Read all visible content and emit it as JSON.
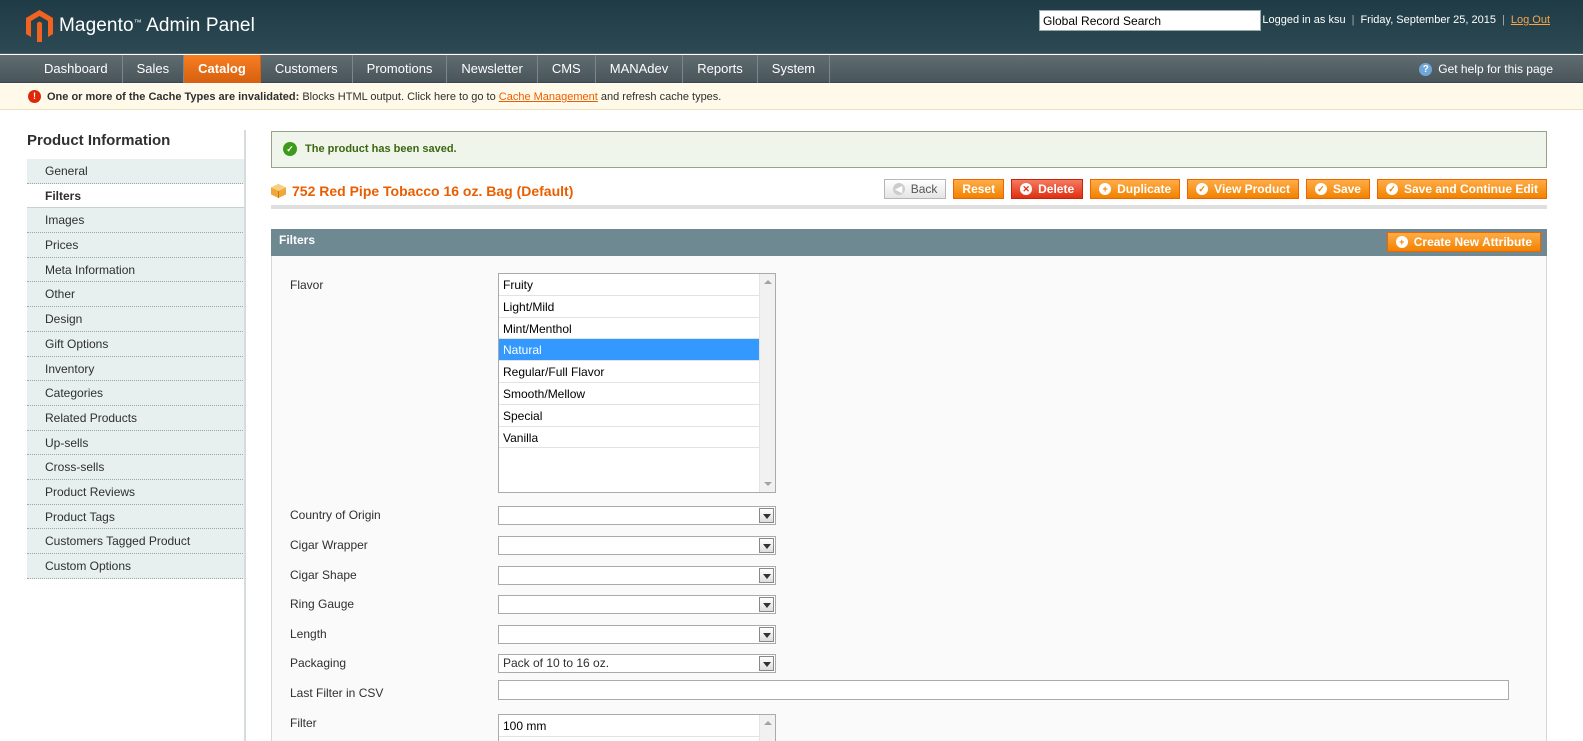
{
  "header": {
    "logo_text": "Magento",
    "logo_tm": "™",
    "logo_suffix": "Admin Panel",
    "search_value": "Global Record Search",
    "logged_in": "Logged in as ksu",
    "date": "Friday, September 25, 2015",
    "logout": "Log Out",
    "sep": "|"
  },
  "nav": {
    "items": [
      "Dashboard",
      "Sales",
      "Catalog",
      "Customers",
      "Promotions",
      "Newsletter",
      "CMS",
      "MANAdev",
      "Reports",
      "System"
    ],
    "active": "Catalog",
    "help": "Get help for this page"
  },
  "notice": {
    "bold": "One or more of the Cache Types are invalidated:",
    "text1": " Blocks HTML output. Click here to go to ",
    "link": "Cache Management",
    "text2": " and refresh cache types."
  },
  "sidebar": {
    "title": "Product Information",
    "items": [
      "General",
      "Filters",
      "Images",
      "Prices",
      "Meta Information",
      "Other",
      "Design",
      "Gift Options",
      "Inventory",
      "Categories",
      "Related Products",
      "Up-sells",
      "Cross-sells",
      "Product Reviews",
      "Product Tags",
      "Customers Tagged Product",
      "Custom Options"
    ],
    "active": "Filters"
  },
  "message": {
    "success": "The product has been saved."
  },
  "page": {
    "title": "752 Red Pipe Tobacco 16 oz. Bag (Default)",
    "buttons": {
      "back": "Back",
      "reset": "Reset",
      "delete": "Delete",
      "duplicate": "Duplicate",
      "view": "View Product",
      "save": "Save",
      "save_continue": "Save and Continue Edit"
    }
  },
  "fieldset": {
    "title": "Filters",
    "create_attr": "Create New Attribute",
    "flavor": {
      "label": "Flavor",
      "options": [
        "Fruity",
        "Light/Mild",
        "Mint/Menthol",
        "Natural",
        "Regular/Full Flavor",
        "Smooth/Mellow",
        "Special",
        "Vanilla"
      ],
      "selected": "Natural"
    },
    "country": {
      "label": "Country of Origin",
      "value": ""
    },
    "wrapper": {
      "label": "Cigar Wrapper",
      "value": ""
    },
    "shape": {
      "label": "Cigar Shape",
      "value": ""
    },
    "ring": {
      "label": "Ring Gauge",
      "value": ""
    },
    "length": {
      "label": "Length",
      "value": ""
    },
    "packaging": {
      "label": "Packaging",
      "value": "Pack of 10 to 16 oz."
    },
    "last_filter": {
      "label": "Last Filter in CSV",
      "value": ""
    },
    "filter": {
      "label": "Filter",
      "options": [
        "100 mm"
      ]
    }
  },
  "colors": {
    "accent": "#eb5e00",
    "nav_active": "#f77e21",
    "header_bg": "#1f3b45",
    "selected_option": "#3399ff"
  }
}
